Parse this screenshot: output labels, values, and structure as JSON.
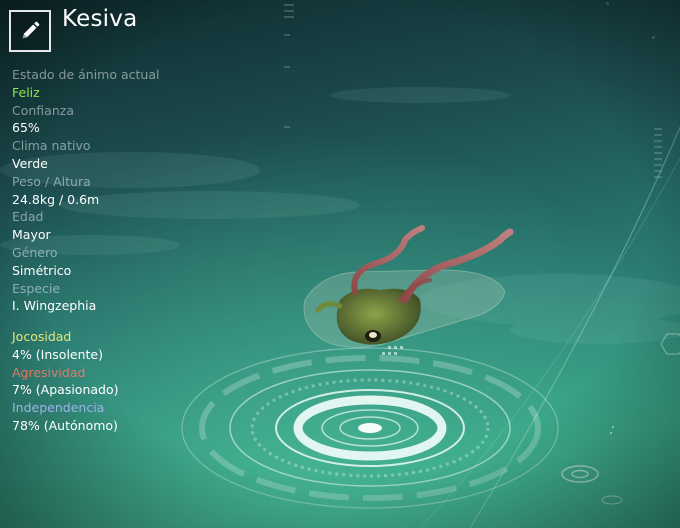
{
  "creature": {
    "name": "Kesiva"
  },
  "stats": [
    {
      "label": "Estado de ánimo actual",
      "value": "Feliz"
    },
    {
      "label": "Confianza",
      "value": "65%"
    },
    {
      "label": "Clima nativo",
      "value": "Verde"
    },
    {
      "label": "Peso / Altura",
      "value": "24.8kg / 0.6m"
    },
    {
      "label": "Edad",
      "value": "Mayor"
    },
    {
      "label": "Género",
      "value": "Simétrico"
    },
    {
      "label": "Especie",
      "value": "I. Wingzephia"
    }
  ],
  "traits": [
    {
      "label": "Jocosidad",
      "value": "4% (Insolente)"
    },
    {
      "label": "Agresividad",
      "value": "7% (Apasionado)"
    },
    {
      "label": "Independencia",
      "value": "78% (Autónomo)"
    }
  ],
  "colors": {
    "mood": "#8de54a",
    "jocosidad": "#e6e47a",
    "agresividad": "#e07a66",
    "independencia": "#9fb3ea",
    "label_gray": "#b9c4c6"
  },
  "icons": {
    "edit": "pencil-icon"
  }
}
